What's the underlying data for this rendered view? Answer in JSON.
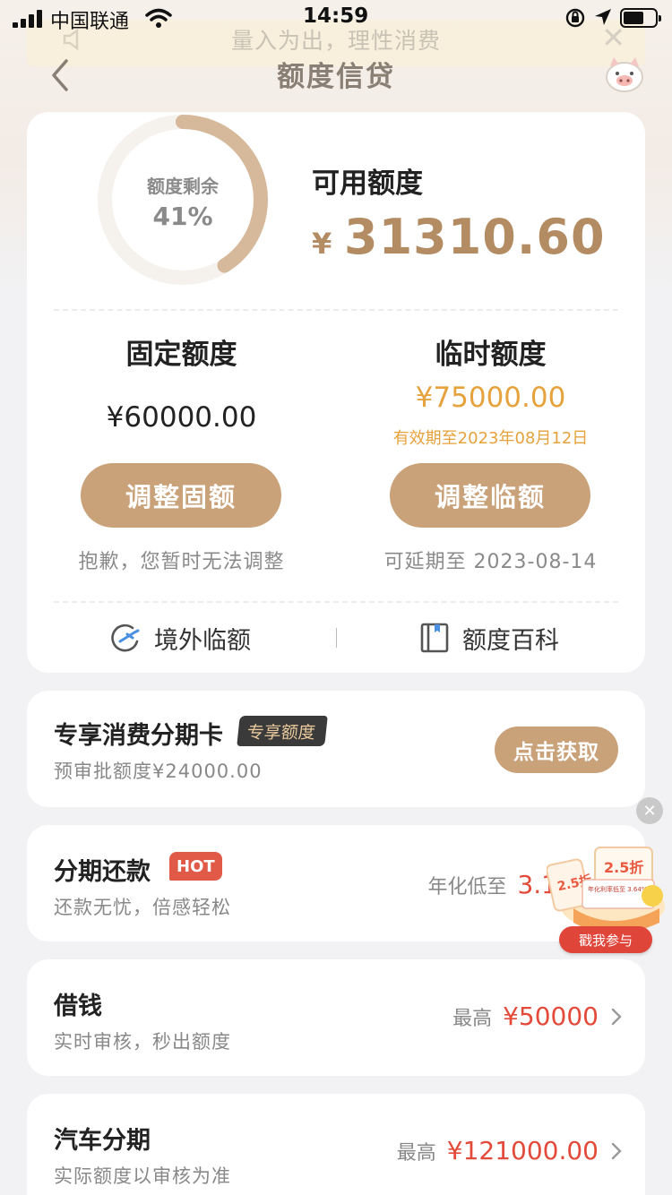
{
  "status_bar": {
    "carrier": "中国联通",
    "time": "14:59"
  },
  "notice": {
    "text": "量入为出，理性消费"
  },
  "nav": {
    "title": "额度信贷"
  },
  "credit": {
    "ring_label": "额度剩余",
    "remaining_percent": "41%",
    "remaining_fraction": 0.41,
    "available_label": "可用额度",
    "available_currency": "¥",
    "available_amount": "31310.60"
  },
  "fixed": {
    "title": "固定额度",
    "amount": "¥60000.00",
    "button": "调整固额",
    "note": "抱歉，您暂时无法调整"
  },
  "temporary": {
    "title": "临时额度",
    "amount": "¥75000.00",
    "valid_until": "有效期至2023年08月12日",
    "button": "调整临额",
    "note": "可延期至 2023-08-14"
  },
  "links": {
    "overseas": "境外临额",
    "wiki": "额度百科"
  },
  "cards": {
    "installment_card": {
      "title": "专享消费分期卡",
      "tag": "专享额度",
      "subtitle": "预审批额度¥24000.00",
      "button": "点击获取"
    },
    "repay": {
      "title": "分期还款",
      "tag": "HOT",
      "subtitle": "还款无忧，倍感轻松",
      "rate_label": "年化低至",
      "rate_value": "3.1"
    },
    "borrow": {
      "title": "借钱",
      "subtitle": "实时审核，秒出额度",
      "max_label": "最高",
      "max_amount": "¥50000"
    },
    "car": {
      "title": "汽车分期",
      "subtitle": "实际额度以审核为准",
      "max_label": "最高",
      "max_amount": "¥121000.00"
    }
  },
  "promo": {
    "badge": "2.5折",
    "note": "年化利率低至 3.64%",
    "button": "戳我参与"
  },
  "colors": {
    "gold": "#c9a27a",
    "gold_text": "#b38c63",
    "orange": "#e6a23c",
    "red": "#e34a3a"
  }
}
